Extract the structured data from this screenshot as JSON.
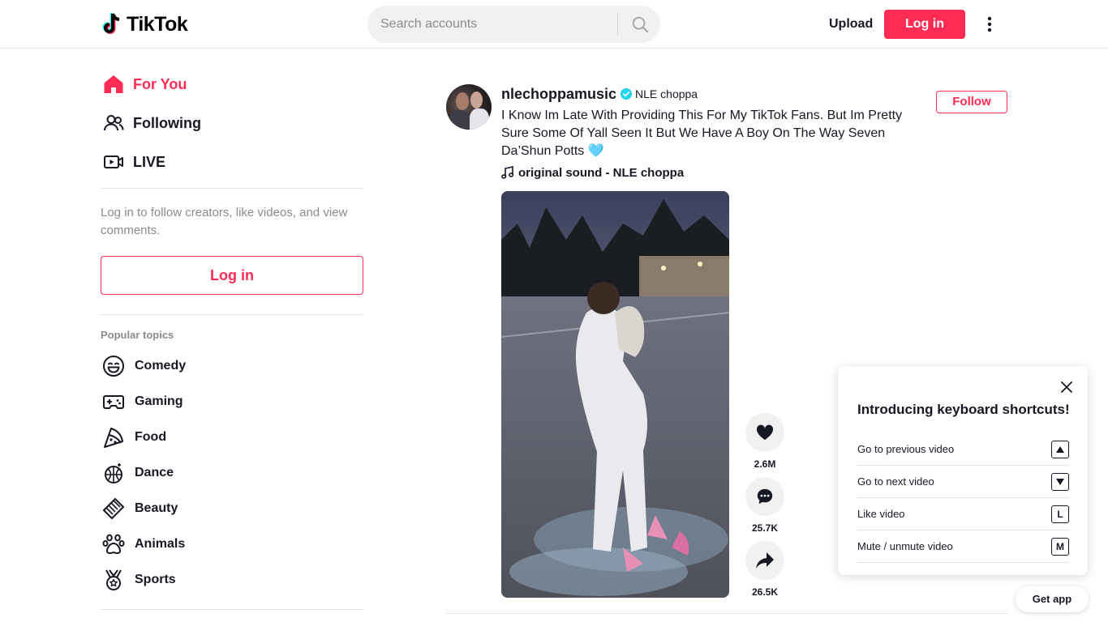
{
  "header": {
    "logo_text": "TikTok",
    "search_placeholder": "Search accounts",
    "upload_label": "Upload",
    "login_label": "Log in"
  },
  "sidebar": {
    "nav": [
      {
        "label": "For You",
        "icon": "home-icon",
        "active": true
      },
      {
        "label": "Following",
        "icon": "users-icon"
      },
      {
        "label": "LIVE",
        "icon": "live-icon"
      }
    ],
    "login_hint": "Log in to follow creators, like videos, and view comments.",
    "login_button": "Log in",
    "topics_title": "Popular topics",
    "topics": [
      {
        "label": "Comedy",
        "icon": "smile-icon"
      },
      {
        "label": "Gaming",
        "icon": "gamepad-icon"
      },
      {
        "label": "Food",
        "icon": "pizza-icon"
      },
      {
        "label": "Dance",
        "icon": "disco-ball-icon"
      },
      {
        "label": "Beauty",
        "icon": "comb-icon"
      },
      {
        "label": "Animals",
        "icon": "paw-icon"
      },
      {
        "label": "Sports",
        "icon": "medal-icon"
      }
    ]
  },
  "post": {
    "username": "nlechoppamusic",
    "nickname": "NLE choppa",
    "follow_label": "Follow",
    "caption": "I Know Im Late With Providing This For My TikTok Fans. But Im Pretty Sure Some Of Yall Seen It But We Have A Boy On The Way Seven Da’Shun Potts 🩵",
    "music": "original sound - NLE choppa",
    "likes": "2.6M",
    "comments": "25.7K",
    "shares": "26.5K"
  },
  "shortcuts": {
    "title": "Introducing keyboard shortcuts!",
    "items": [
      {
        "label": "Go to previous video",
        "key": "▲"
      },
      {
        "label": "Go to next video",
        "key": "▼"
      },
      {
        "label": "Like video",
        "key": "L"
      },
      {
        "label": "Mute / unmute video",
        "key": "M"
      }
    ]
  },
  "get_app": "Get app",
  "colors": {
    "accent": "#fe2c55",
    "verified": "#20d5ec"
  }
}
